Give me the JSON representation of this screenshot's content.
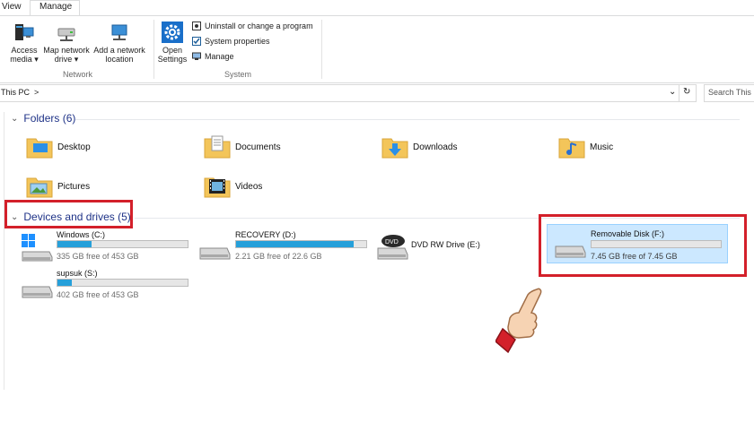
{
  "tabs": {
    "view": "View",
    "manage": "Manage"
  },
  "ribbon": {
    "network": {
      "access_media_line1": "Access",
      "access_media_line2": "media",
      "map_drive_line1": "Map network",
      "map_drive_line2": "drive",
      "add_location_line1": "Add a network",
      "add_location_line2": "location",
      "group_label": "Network"
    },
    "system": {
      "open_settings_line1": "Open",
      "open_settings_line2": "Settings",
      "uninstall": "Uninstall or change a program",
      "system_properties": "System properties",
      "manage": "Manage",
      "group_label": "System"
    }
  },
  "address": {
    "path": "This PC",
    "separator": ">"
  },
  "search": {
    "placeholder": "Search This PC"
  },
  "folders_section": {
    "title": "Folders (6)"
  },
  "folders": [
    {
      "name": "Desktop",
      "icon": "desktop-folder-icon"
    },
    {
      "name": "Documents",
      "icon": "documents-folder-icon"
    },
    {
      "name": "Downloads",
      "icon": "downloads-folder-icon"
    },
    {
      "name": "Music",
      "icon": "music-folder-icon"
    },
    {
      "name": "Pictures",
      "icon": "pictures-folder-icon"
    },
    {
      "name": "Videos",
      "icon": "videos-folder-icon"
    }
  ],
  "devices_section": {
    "title": "Devices and drives (5)"
  },
  "drives": [
    {
      "name": "Windows (C:)",
      "free": "335 GB free of 453 GB",
      "used_fraction": 0.26,
      "icon": "windows-drive-icon"
    },
    {
      "name": "RECOVERY (D:)",
      "free": "2.21 GB free of 22.6 GB",
      "used_fraction": 0.9,
      "icon": "drive-icon"
    },
    {
      "name": "DVD RW Drive (E:)",
      "free": "",
      "icon": "dvd-drive-icon"
    },
    {
      "name": "Removable Disk (F:)",
      "free": "7.45 GB free of 7.45 GB",
      "used_fraction": 0.0,
      "icon": "removable-drive-icon",
      "selected": true
    },
    {
      "name": "supsuk (S:)",
      "free": "402 GB free of 453 GB",
      "used_fraction": 0.11,
      "icon": "drive-icon"
    }
  ],
  "colors": {
    "accent": "#26a0da",
    "highlight_box": "#d3202a",
    "selection": "#cce8ff",
    "section_text": "#1e3287"
  }
}
